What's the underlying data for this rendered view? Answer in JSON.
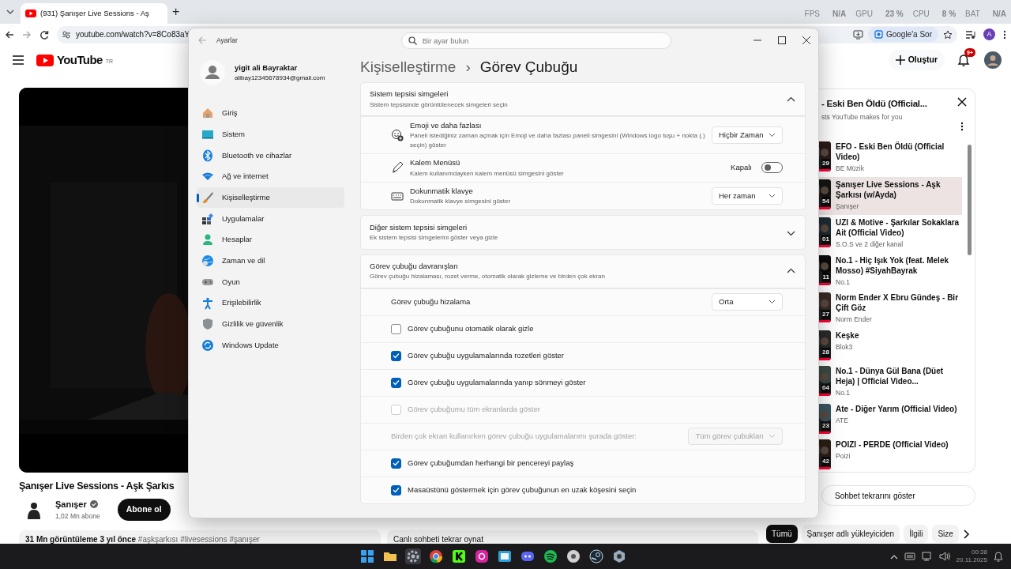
{
  "browser": {
    "tab_title": "(931) Şanışer Live Sessions - Aş",
    "new_tab": "+",
    "url": "youtube.com/watch?v=8Co83aY",
    "ask_google": "Google'a Sor",
    "profile_initial": "A"
  },
  "overlay_stats": [
    {
      "label": "FPS",
      "value": "N/A"
    },
    {
      "label": "GPU",
      "value": "23 %"
    },
    {
      "label": "CPU",
      "value": "8 %"
    },
    {
      "label": "BAT",
      "value": "N/A"
    }
  ],
  "youtube": {
    "logo": "YouTube",
    "region": "TR",
    "create": "Oluştur",
    "notifications": "9+",
    "video_title": "Şanışer Live Sessions - Aşk Şarkıs",
    "channel": "Şanışer",
    "subscribers": "1,02 Mn abone",
    "subscribe": "Abone ol",
    "views": "31 Mn görüntüleme",
    "age": "3 yıl önce",
    "hashtags": "#aşkşarkısı #livesessions #şanışer",
    "chat_replay": "Canlı sohbeti tekrar oynat",
    "playlist": {
      "title": "- Eski Ben Öldü (Official...",
      "subtitle": "sts YouTube makes for you",
      "items": [
        {
          "title": "EFO - Eski Ben Öldü (Official Video)",
          "channel": "BE Müzik",
          "duration": "29",
          "selected": false
        },
        {
          "title": "Şanışer Live Sessions - Aşk Şarkısı (w/Ayda)",
          "channel": "Şanışer",
          "duration": "54",
          "selected": true
        },
        {
          "title": "UZI & Motive - Şarkılar Sokaklara Ait (Official Video)",
          "channel": "S.O.S ve 2 diğer kanal",
          "duration": "01",
          "selected": false
        },
        {
          "title": "No.1 - Hiç Işık Yok (feat. Melek Mosso) #SiyahBayrak",
          "channel": "No.1",
          "duration": "11",
          "selected": false
        },
        {
          "title": "Norm Ender X Ebru Gündeş - Bir Çift Göz",
          "channel": "Norm Ender",
          "duration": "27",
          "selected": false
        },
        {
          "title": "Keşke",
          "channel": "Blok3",
          "duration": "28",
          "selected": false
        },
        {
          "title": "No.1 - Dünya Gül Bana (Düet Heja) | Official Video...",
          "channel": "No.1",
          "duration": "04",
          "selected": false
        },
        {
          "title": "Ate - Diğer Yarım (Official Video)",
          "channel": "ATE",
          "duration": "23",
          "selected": false
        },
        {
          "title": "POIZI - PERDE (Official Video)",
          "channel": "Poizi",
          "duration": "42",
          "selected": false
        }
      ]
    },
    "show_chat": "Sohbet tekrarını göster",
    "chips": [
      {
        "label": "Tümü",
        "selected": true
      },
      {
        "label": "Şanışer adlı yükleyiciden",
        "selected": false
      },
      {
        "label": "İlgili",
        "selected": false
      },
      {
        "label": "Size",
        "selected": false
      }
    ]
  },
  "settings": {
    "title": "Ayarlar",
    "search_placeholder": "Bir ayar bulun",
    "user": {
      "name": "yigit ali Bayraktar",
      "email": "alibay12345678934@gmail.com"
    },
    "nav": [
      {
        "label": "Giriş",
        "selected": false
      },
      {
        "label": "Sistem",
        "selected": false
      },
      {
        "label": "Bluetooth ve cihazlar",
        "selected": false
      },
      {
        "label": "Ağ ve internet",
        "selected": false
      },
      {
        "label": "Kişiselleştirme",
        "selected": true
      },
      {
        "label": "Uygulamalar",
        "selected": false
      },
      {
        "label": "Hesaplar",
        "selected": false
      },
      {
        "label": "Zaman ve dil",
        "selected": false
      },
      {
        "label": "Oyun",
        "selected": false
      },
      {
        "label": "Erişilebilirlik",
        "selected": false
      },
      {
        "label": "Gizlilik ve güvenlik",
        "selected": false
      },
      {
        "label": "Windows Update",
        "selected": false
      }
    ],
    "breadcrumb": {
      "parent": "Kişiselleştirme",
      "separator": "›",
      "current": "Görev Çubuğu"
    },
    "sections": [
      {
        "title": "Sistem tepsisi simgeleri",
        "subtitle": "Sistem tepsisinde görüntülenecek simgeleri seçin",
        "expanded": true,
        "rows": [
          {
            "kind": "dropdown",
            "title": "Emoji ve daha fazlası",
            "subtitle": "Paneli istediğiniz zaman açmak için Emoji ve daha fazlası paneli simgesini (Windows logo tuşu + nokta (.) seçin) göster",
            "value": "Hiçbir Zaman",
            "disabled": false
          },
          {
            "kind": "toggle",
            "title": "Kalem Menüsü",
            "subtitle": "Kalem kullanımdayken kalem menüsü simgesini göster",
            "state_label": "Kapalı",
            "on": false
          },
          {
            "kind": "dropdown",
            "title": "Dokunmatik klavye",
            "subtitle": "Dokunmatik klavye simgesini göster",
            "value": "Her zaman",
            "disabled": false
          }
        ]
      },
      {
        "title": "Diğer sistem tepsisi simgeleri",
        "subtitle": "Ek sistem tepsisi simgelerini göster veya gizle",
        "expanded": false
      },
      {
        "title": "Görev çubuğu davranışları",
        "subtitle": "Görev çubuğu hizalaması, rozet verme, otomatik olarak gizleme ve birden çok ekran",
        "expanded": true,
        "rows": [
          {
            "kind": "dropdown",
            "title": "Görev çubuğu hizalama",
            "value": "Orta",
            "disabled": false
          },
          {
            "kind": "checkbox",
            "title": "Görev çubuğunu otomatik olarak gizle",
            "checked": false,
            "disabled": false
          },
          {
            "kind": "checkbox",
            "title": "Görev çubuğu uygulamalarında rozetleri göster",
            "checked": true,
            "disabled": false
          },
          {
            "kind": "checkbox",
            "title": "Görev çubuğu uygulamalarında yanıp sönmeyi göster",
            "checked": true,
            "disabled": false
          },
          {
            "kind": "checkbox",
            "title": "Görev çubuğumu tüm ekranlarda göster",
            "checked": false,
            "disabled": true
          },
          {
            "kind": "dropdown",
            "title": "Birden çok ekran kullanırken görev çubuğu uygulamalarımı şurada göster:",
            "value": "Tüm görev çubukları",
            "disabled": true
          },
          {
            "kind": "checkbox",
            "title": "Görev çubuğumdan herhangi bir pencereyi paylaş",
            "checked": true,
            "disabled": false
          },
          {
            "kind": "checkbox",
            "title": "Masaüstünü göstermek için görev çubuğunun en uzak köşesini seçin",
            "checked": true,
            "disabled": false
          }
        ]
      }
    ]
  },
  "taskbar": {
    "time": "00:38",
    "date": "20.11.2025"
  }
}
